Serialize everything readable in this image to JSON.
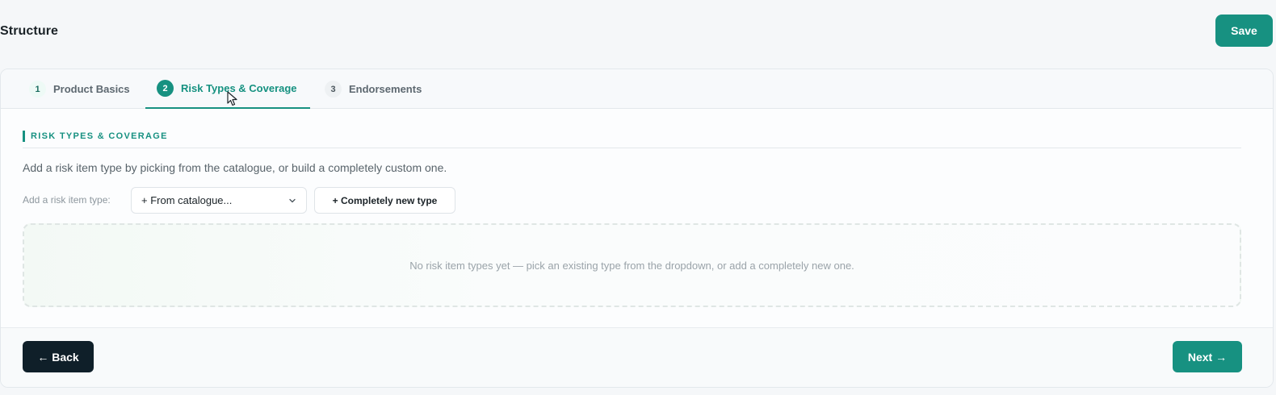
{
  "header": {
    "title": "Structure",
    "save_label": "Save"
  },
  "tabs": [
    {
      "number": "1",
      "label": "Product Basics",
      "active": false
    },
    {
      "number": "2",
      "label": "Risk Types & Coverage",
      "active": true
    },
    {
      "number": "3",
      "label": "Endorsements",
      "active": false
    }
  ],
  "section": {
    "title": "RISK TYPES & COVERAGE",
    "description": "Add a risk item type by picking from the catalogue, or build a completely custom one."
  },
  "add_row": {
    "label": "Add a risk item type:",
    "select_value": "+ From catalogue...",
    "new_type_label": "+ Completely new type"
  },
  "empty_state": "No risk item types yet — pick an existing type from the dropdown, or add a completely new one.",
  "footer": {
    "back_label": "← Back",
    "next_label": "Next →"
  },
  "colors": {
    "accent": "#179181",
    "dark": "#0f1f29"
  }
}
